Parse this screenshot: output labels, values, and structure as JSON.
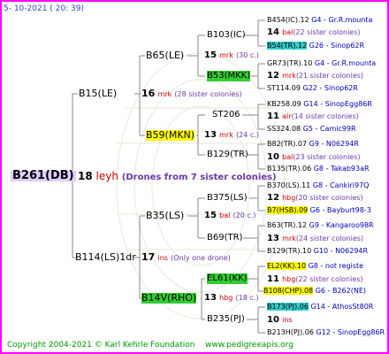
{
  "header": {
    "date": "5- 10-2021 ( 20: 39)"
  },
  "footer": {
    "copyright": "Copyright 2004-2021 © Karl Kehrle Foundation",
    "url": "www.pedigreeapis.org"
  },
  "colors": {
    "border": "#ff00ff",
    "yellow": "#ffff00",
    "green": "#33cc33",
    "cyan": "#33cccc",
    "blue_text": "#0000bb",
    "brown_text": "#996600",
    "root_bg": "#ddccff"
  },
  "root": {
    "name": "B261(DB)",
    "gen": "18",
    "mark": "leyh",
    "note": "(Drones from 7 sister colonies)"
  },
  "gen1": [
    {
      "name": "B15(LE)",
      "gen": "16",
      "mark": "mrk",
      "note": "(28 sister colonies)"
    },
    {
      "name": "B114(LS)1dr",
      "gen": "17",
      "mark": "ins",
      "note": "(Only one drone)"
    }
  ],
  "gen2": [
    {
      "name": "B65(LE)",
      "gen": "15",
      "mark": "mrk",
      "note": "(30 c.)"
    },
    {
      "name": "B59(MKN)",
      "gen": "13",
      "mark": "mrk",
      "note": "(24 c.)"
    },
    {
      "name": "B35(LS)",
      "gen": "15",
      "mark": "bal",
      "note": "(20 c.)"
    },
    {
      "name": "B14V(RHO)",
      "gen": "13",
      "mark": "hbg",
      "note": "(18 c.)"
    }
  ],
  "gen3": [
    {
      "name": "B103(IC)",
      "gen": "14",
      "mark": "bal",
      "note": "(22 sister colonies)"
    },
    {
      "name": "B53(MKK)",
      "gen": "12",
      "mark": "mrk",
      "note": "(21 sister colonies)"
    },
    {
      "name": "ST206",
      "gen": "11",
      "mark": "alr",
      "note": "(14 sister colonies)"
    },
    {
      "name": "B129(TR)",
      "gen": "10",
      "mark": "bal",
      "note": "(23 sister colonies)"
    },
    {
      "name": "B375(LS)",
      "gen": "12",
      "mark": "hbg",
      "note": "(20 sister colonies)"
    },
    {
      "name": "B69(TR)",
      "gen": "13",
      "mark": "mrk",
      "note": "(24 sister colonies)"
    },
    {
      "name": "EL61(KK)",
      "gen": "11",
      "mark": "hbg",
      "note": "(22 sister colonies)"
    },
    {
      "name": "B235(PJ)",
      "gen": "10",
      "mark": "ins",
      "note": ""
    }
  ],
  "gen4": [
    {
      "name": "B454(IC).12",
      "info": "G4 - Gr.R.mounta"
    },
    {
      "name": "B54(TR).12",
      "info": "G26 - Sinop62R"
    },
    {
      "name": "GR73(TR).10",
      "info": "G4 - Gr.R.mounta"
    },
    {
      "name": "ST114.09",
      "info": "G22 - Sinop62R"
    },
    {
      "name": "KB258.09",
      "info": "G14 - SinopEgg86R"
    },
    {
      "name": "SS324.08",
      "info": "G5 - Camic99R"
    },
    {
      "name": "B82(TR).07",
      "info": "G9 - N06294R"
    },
    {
      "name": "B135(TR).06",
      "info": "G8 - Takab93aR"
    },
    {
      "name": "B370(LS).11",
      "info": "G8 - Cankiri97Q"
    },
    {
      "name": "B7(HSB).09",
      "info": "G6 - Bayburt98-3"
    },
    {
      "name": "B63(TR).12",
      "info": "G9 - Kangaroo98R"
    },
    {
      "name": "B129(TR).10",
      "info": "G10 - N06294R"
    },
    {
      "name": "EL2(KK).10",
      "info": "G8 - not registe"
    },
    {
      "name": "B108(CHP).08",
      "info": "G6 - B262(NE)"
    },
    {
      "name": "B173(PJ).06",
      "info": "G14 - AthosSt80R"
    },
    {
      "name": "B213H(PJ).06",
      "info": "G12 - SinopEgg86R"
    }
  ]
}
